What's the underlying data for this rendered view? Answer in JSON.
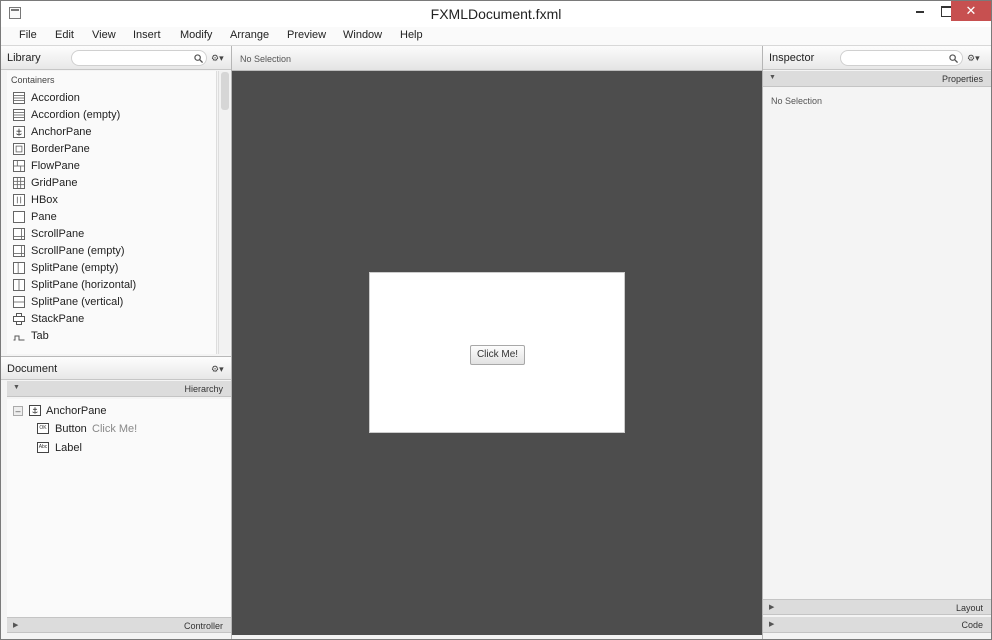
{
  "window": {
    "title": "FXMLDocument.fxml",
    "close_glyph": "✕"
  },
  "menu": [
    "File",
    "Edit",
    "View",
    "Insert",
    "Modify",
    "Arrange",
    "Preview",
    "Window",
    "Help"
  ],
  "library": {
    "title": "Library",
    "search_placeholder": "",
    "category": "Containers",
    "items": [
      "Accordion",
      "Accordion  (empty)",
      "AnchorPane",
      "BorderPane",
      "FlowPane",
      "GridPane",
      "HBox",
      "Pane",
      "ScrollPane",
      "ScrollPane  (empty)",
      "SplitPane  (empty)",
      "SplitPane  (horizontal)",
      "SplitPane  (vertical)",
      "StackPane",
      "Tab"
    ]
  },
  "document": {
    "title": "Document",
    "section": "Hierarchy",
    "tree": [
      {
        "label": "AnchorPane",
        "sub": "",
        "icon": "anchorpane-icon"
      },
      {
        "label": "Button",
        "sub": "Click Me!",
        "icon": "button-icon",
        "icon_text": "OK"
      },
      {
        "label": "Label",
        "sub": "",
        "icon": "label-icon",
        "icon_text": "Abc"
      }
    ],
    "expander": "–",
    "controller": "Controller"
  },
  "canvas": {
    "status": "No Selection",
    "button_label": "Click Me!"
  },
  "inspector": {
    "title": "Inspector",
    "search_placeholder": "",
    "properties": "Properties",
    "no_selection": "No Selection",
    "layout": "Layout",
    "code": "Code"
  }
}
